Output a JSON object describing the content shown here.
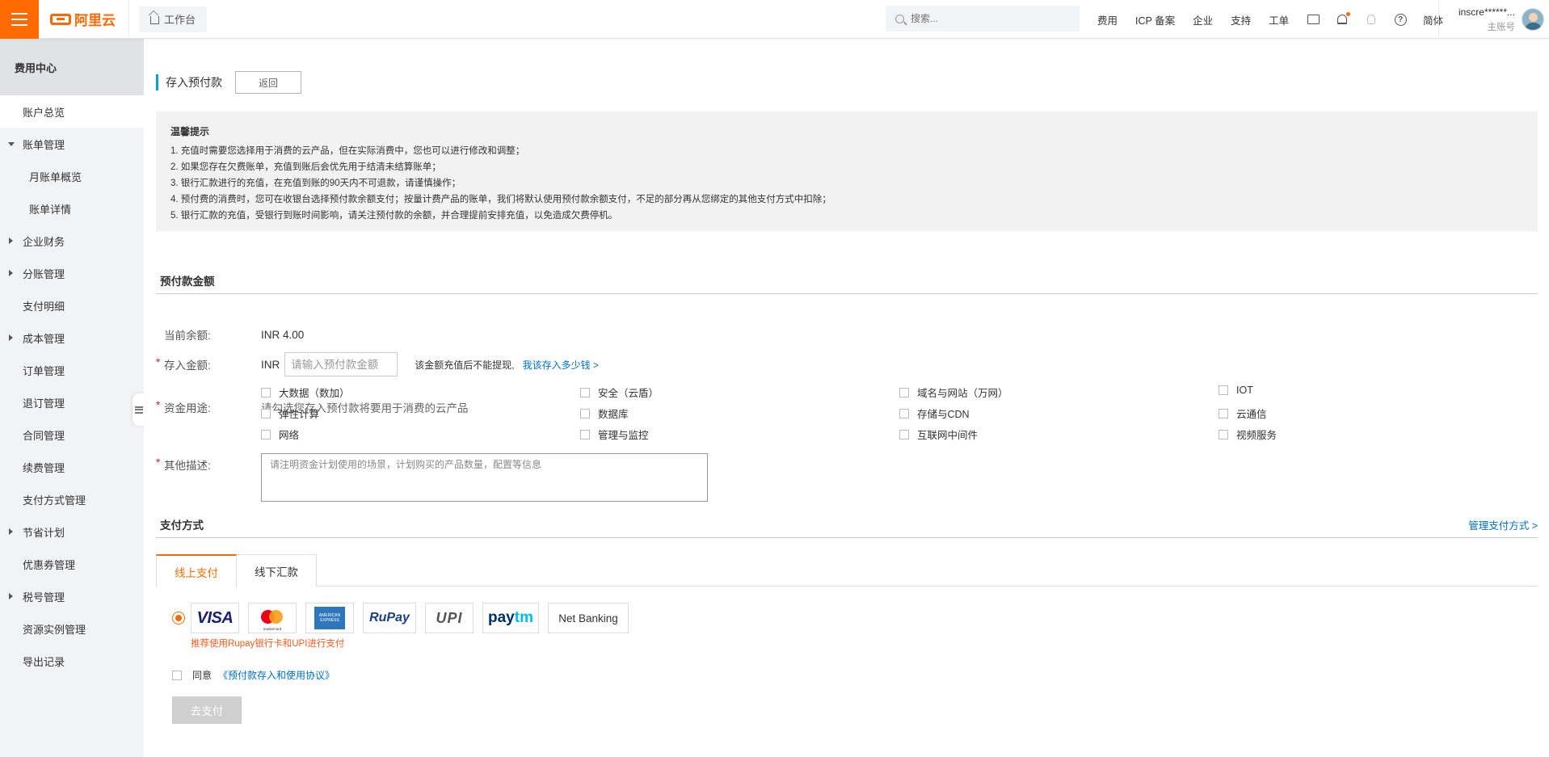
{
  "header": {
    "logo_text": "阿里云",
    "workbench_label": "工作台",
    "search_placeholder": "搜索...",
    "nav_links": [
      "费用",
      "ICP 备案",
      "企业",
      "支持",
      "工单"
    ],
    "lang_label": "简体",
    "user_name": "inscre******...",
    "user_role": "主账号"
  },
  "sidebar": {
    "title": "费用中心",
    "items": [
      {
        "label": "账户总览"
      },
      {
        "label": "账单管理"
      },
      {
        "label": "月账单概览"
      },
      {
        "label": "账单详情"
      },
      {
        "label": "企业财务"
      },
      {
        "label": "分账管理"
      },
      {
        "label": "支付明细"
      },
      {
        "label": "成本管理"
      },
      {
        "label": "订单管理"
      },
      {
        "label": "退订管理"
      },
      {
        "label": "合同管理"
      },
      {
        "label": "续费管理"
      },
      {
        "label": "支付方式管理"
      },
      {
        "label": "节省计划"
      },
      {
        "label": "优惠券管理"
      },
      {
        "label": "税号管理"
      },
      {
        "label": "资源实例管理"
      },
      {
        "label": "导出记录"
      }
    ]
  },
  "page": {
    "title": "存入预付款",
    "back_label": "返回"
  },
  "notice": {
    "title": "温馨提示",
    "lines": [
      "1. 充值时需要您选择用于消费的云产品，但在实际消费中，您也可以进行修改和调整；",
      "2. 如果您存在欠费账单，充值到账后会优先用于结清未结算账单；",
      "3. 银行汇款进行的充值，在充值到账的90天内不可退款，请谨慎操作；",
      "4. 预付费的消费时，您可在收银台选择预付款余额支付；按量计费产品的账单，我们将默认使用预付款余额支付，不足的部分再从您绑定的其他支付方式中扣除；",
      "5. 银行汇款的充值，受银行到账时间影响，请关注预付款的余额，并合理提前安排充值，以免造成欠费停机。"
    ]
  },
  "prepay": {
    "section_title": "预付款金额",
    "balance_label": "当前余额:",
    "balance_value": "INR 4.00",
    "amount_label": "存入金额:",
    "amount_currency": "INR",
    "amount_placeholder": "请输入预付款金额",
    "amount_hint": "该金额充值后不能提现,",
    "amount_link": "我该存入多少钱 >",
    "usage_label": "资金用途:",
    "usage_prompt": "请勾选您存入预付款将要用于消费的云产品",
    "usage_options": [
      "大数据（数加）",
      "安全（云盾）",
      "域名与网站（万网）",
      "IOT",
      "弹性计算",
      "数据库",
      "存储与CDN",
      "云通信",
      "网络",
      "管理与监控",
      "互联网中间件",
      "视频服务"
    ],
    "desc_label": "其他描述:",
    "desc_placeholder": "请注明资金计划使用的场景，计划购买的产品数量，配置等信息"
  },
  "payment": {
    "section_title": "支付方式",
    "manage_link": "管理支付方式 >",
    "tabs": [
      "线上支付",
      "线下汇款"
    ],
    "methods": {
      "visa": "VISA",
      "mastercard": "mastercard",
      "amex": "AMERICAN EXPRESS",
      "rupay": "RuPay",
      "upi": "UPI",
      "paytm_a": "pay",
      "paytm_b": "tm",
      "netbanking": "Net Banking"
    },
    "hint": "推荐使用Rupay银行卡和UPI进行支付",
    "agree_label": "同意",
    "agree_link": "《预付款存入和使用协议》",
    "pay_button": "去支付"
  },
  "colors": {
    "brand": "#ff6a00",
    "link": "#0070cc",
    "accent_bar": "#00a1d6"
  }
}
